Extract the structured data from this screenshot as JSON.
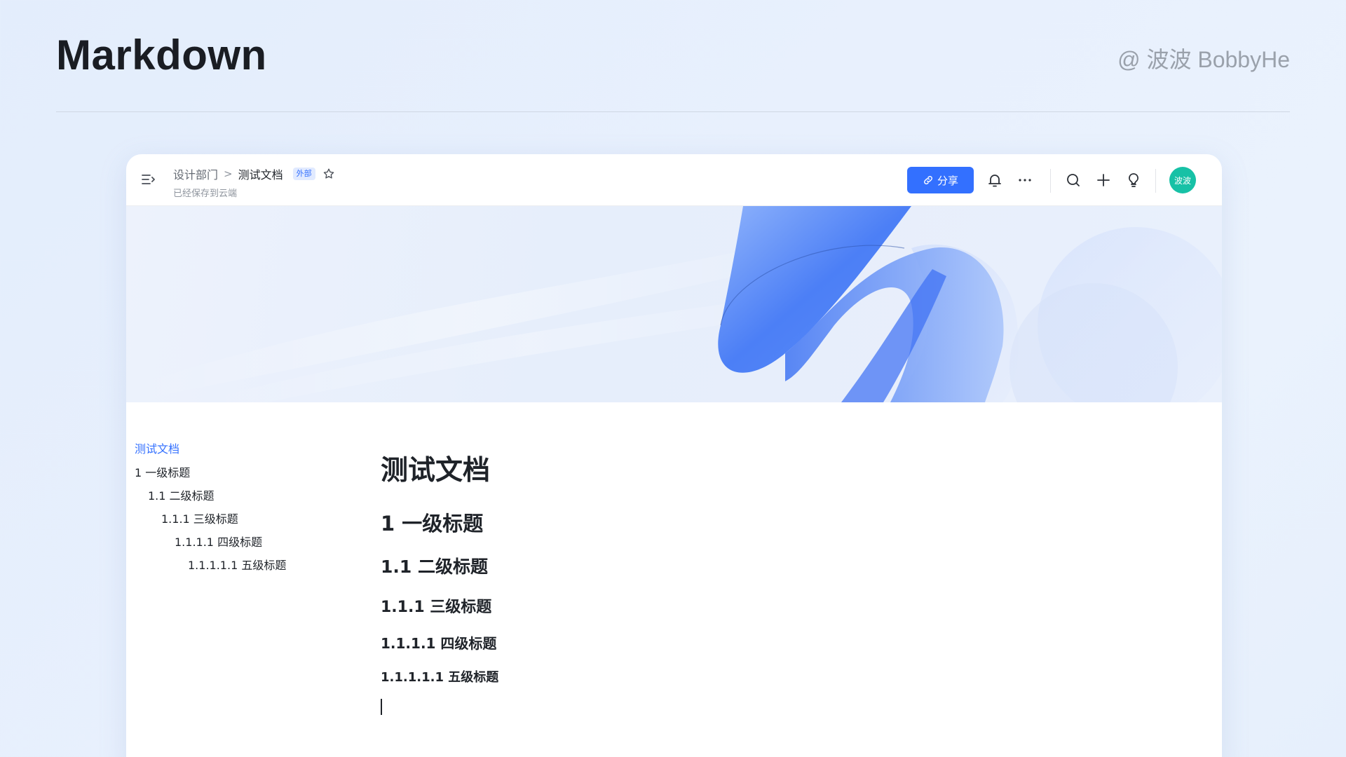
{
  "slide": {
    "title": "Markdown",
    "author": "@ 波波 BobbyHe"
  },
  "topbar": {
    "breadcrumb_parent": "设计部门",
    "breadcrumb_separator": ">",
    "breadcrumb_current": "测试文档",
    "tag": "外部",
    "save_status": "已经保存到云端",
    "share_label": "分享",
    "avatar_text": "波波",
    "icons": [
      "menu-fold-icon",
      "star-icon",
      "link-icon",
      "bell-icon",
      "more-icon",
      "search-icon",
      "plus-icon",
      "bulb-icon"
    ]
  },
  "toc": {
    "items": [
      {
        "label": "测试文档",
        "level": 0,
        "active": true
      },
      {
        "label": "1 一级标题",
        "level": 1
      },
      {
        "label": "1.1 二级标题",
        "level": 2
      },
      {
        "label": "1.1.1 三级标题",
        "level": 3
      },
      {
        "label": "1.1.1.1 四级标题",
        "level": 4
      },
      {
        "label": "1.1.1.1.1 五级标题",
        "level": 5
      }
    ]
  },
  "doc": {
    "title": "测试文档",
    "headings": [
      {
        "text": "1 一级标题",
        "level": 1
      },
      {
        "text": "1.1 二级标题",
        "level": 2
      },
      {
        "text": "1.1.1 三级标题",
        "level": 3
      },
      {
        "text": "1.1.1.1 四级标题",
        "level": 4
      },
      {
        "text": "1.1.1.1.1 五级标题",
        "level": 5
      }
    ]
  },
  "colors": {
    "accent": "#3370ff",
    "avatar": "#17c1a6"
  }
}
